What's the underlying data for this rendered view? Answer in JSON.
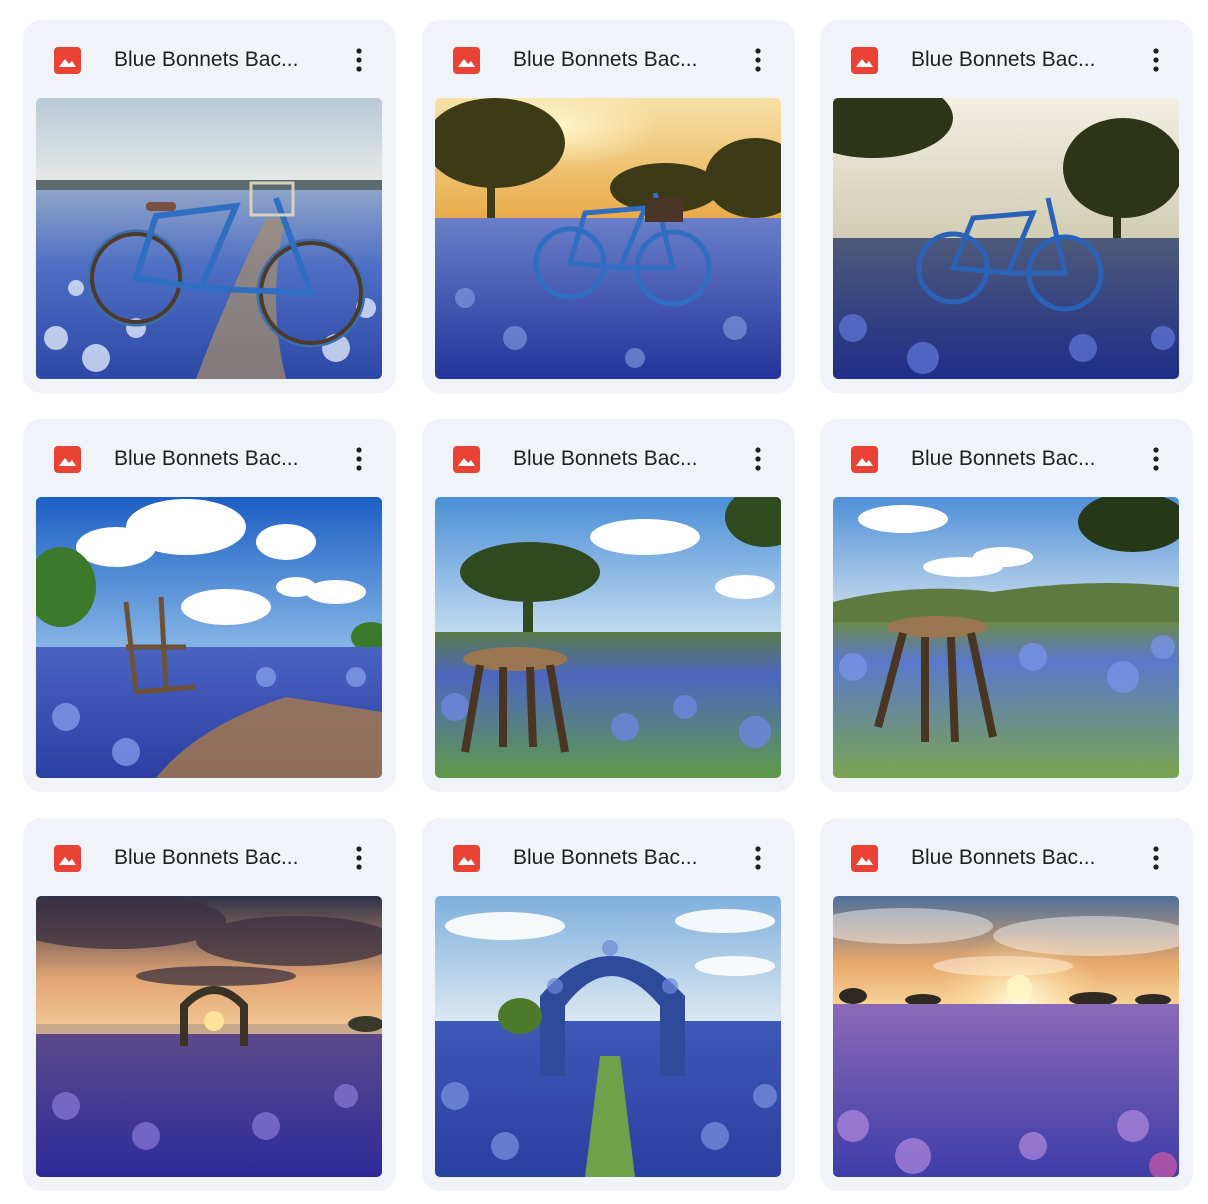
{
  "files": [
    {
      "name": "Blue Bonnets Bac...",
      "icon": "image-file-icon",
      "menu_icon": "more-vert-icon",
      "scene": "bicycle in bluebonnet field by a lake"
    },
    {
      "name": "Blue Bonnets Bac...",
      "icon": "image-file-icon",
      "menu_icon": "more-vert-icon",
      "scene": "bicycle in bluebonnet field at golden sunset with trees"
    },
    {
      "name": "Blue Bonnets Bac...",
      "icon": "image-file-icon",
      "menu_icon": "more-vert-icon",
      "scene": "bicycle in bluebonnet field under trees"
    },
    {
      "name": "Blue Bonnets Bac...",
      "icon": "image-file-icon",
      "menu_icon": "more-vert-icon",
      "scene": "wooden chair in bluebonnet field with blue sky and clouds"
    },
    {
      "name": "Blue Bonnets Bac...",
      "icon": "image-file-icon",
      "menu_icon": "more-vert-icon",
      "scene": "wooden stool in bluebonnet field with tree"
    },
    {
      "name": "Blue Bonnets Bac...",
      "icon": "image-file-icon",
      "menu_icon": "more-vert-icon",
      "scene": "wooden stool in bluebonnet field with hills"
    },
    {
      "name": "Blue Bonnets Bac...",
      "icon": "image-file-icon",
      "menu_icon": "more-vert-icon",
      "scene": "garden arch in bluebonnet field at dramatic sunset"
    },
    {
      "name": "Blue Bonnets Bac...",
      "icon": "image-file-icon",
      "menu_icon": "more-vert-icon",
      "scene": "bluebonnet flower arch over grassy path"
    },
    {
      "name": "Blue Bonnets Bac...",
      "icon": "image-file-icon",
      "menu_icon": "more-vert-icon",
      "scene": "bluebonnet field at sunset"
    }
  ],
  "colors": {
    "card_bg": "#f0f4f9",
    "file_icon": "#ea4335",
    "text": "#1f1f1f",
    "bluebonnet": "#3551b8"
  }
}
